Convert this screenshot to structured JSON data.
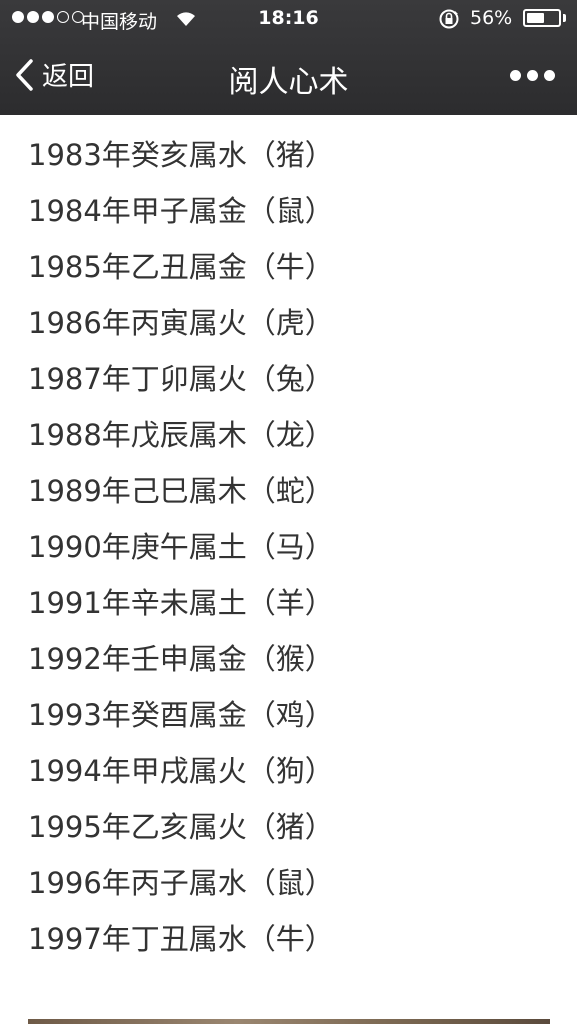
{
  "status_bar": {
    "carrier": "中国移动",
    "time": "18:16",
    "battery_percent": "56%",
    "battery_level": 0.56,
    "signal_bars_filled": 3,
    "signal_bars_total": 5
  },
  "navbar": {
    "back_label": "返回",
    "title": "阅人心术"
  },
  "content": {
    "lines": [
      "1983年癸亥属水（猪）",
      "1984年甲子属金（鼠）",
      "1985年乙丑属金（牛）",
      "1986年丙寅属火（虎）",
      "1987年丁卯属火（兔）",
      "1988年戊辰属木（龙）",
      "1989年己巳属木（蛇）",
      "1990年庚午属土（马）",
      "1991年辛未属土（羊）",
      "1992年壬申属金（猴）",
      "1993年癸酉属金（鸡）",
      "1994年甲戌属火（狗）",
      "1995年乙亥属火（猪）",
      "1996年丙子属水（鼠）",
      "1997年丁丑属水（牛）"
    ]
  },
  "colors": {
    "navbar_bg": "#2f2f31",
    "text": "#333333",
    "page_bg": "#ffffff"
  }
}
